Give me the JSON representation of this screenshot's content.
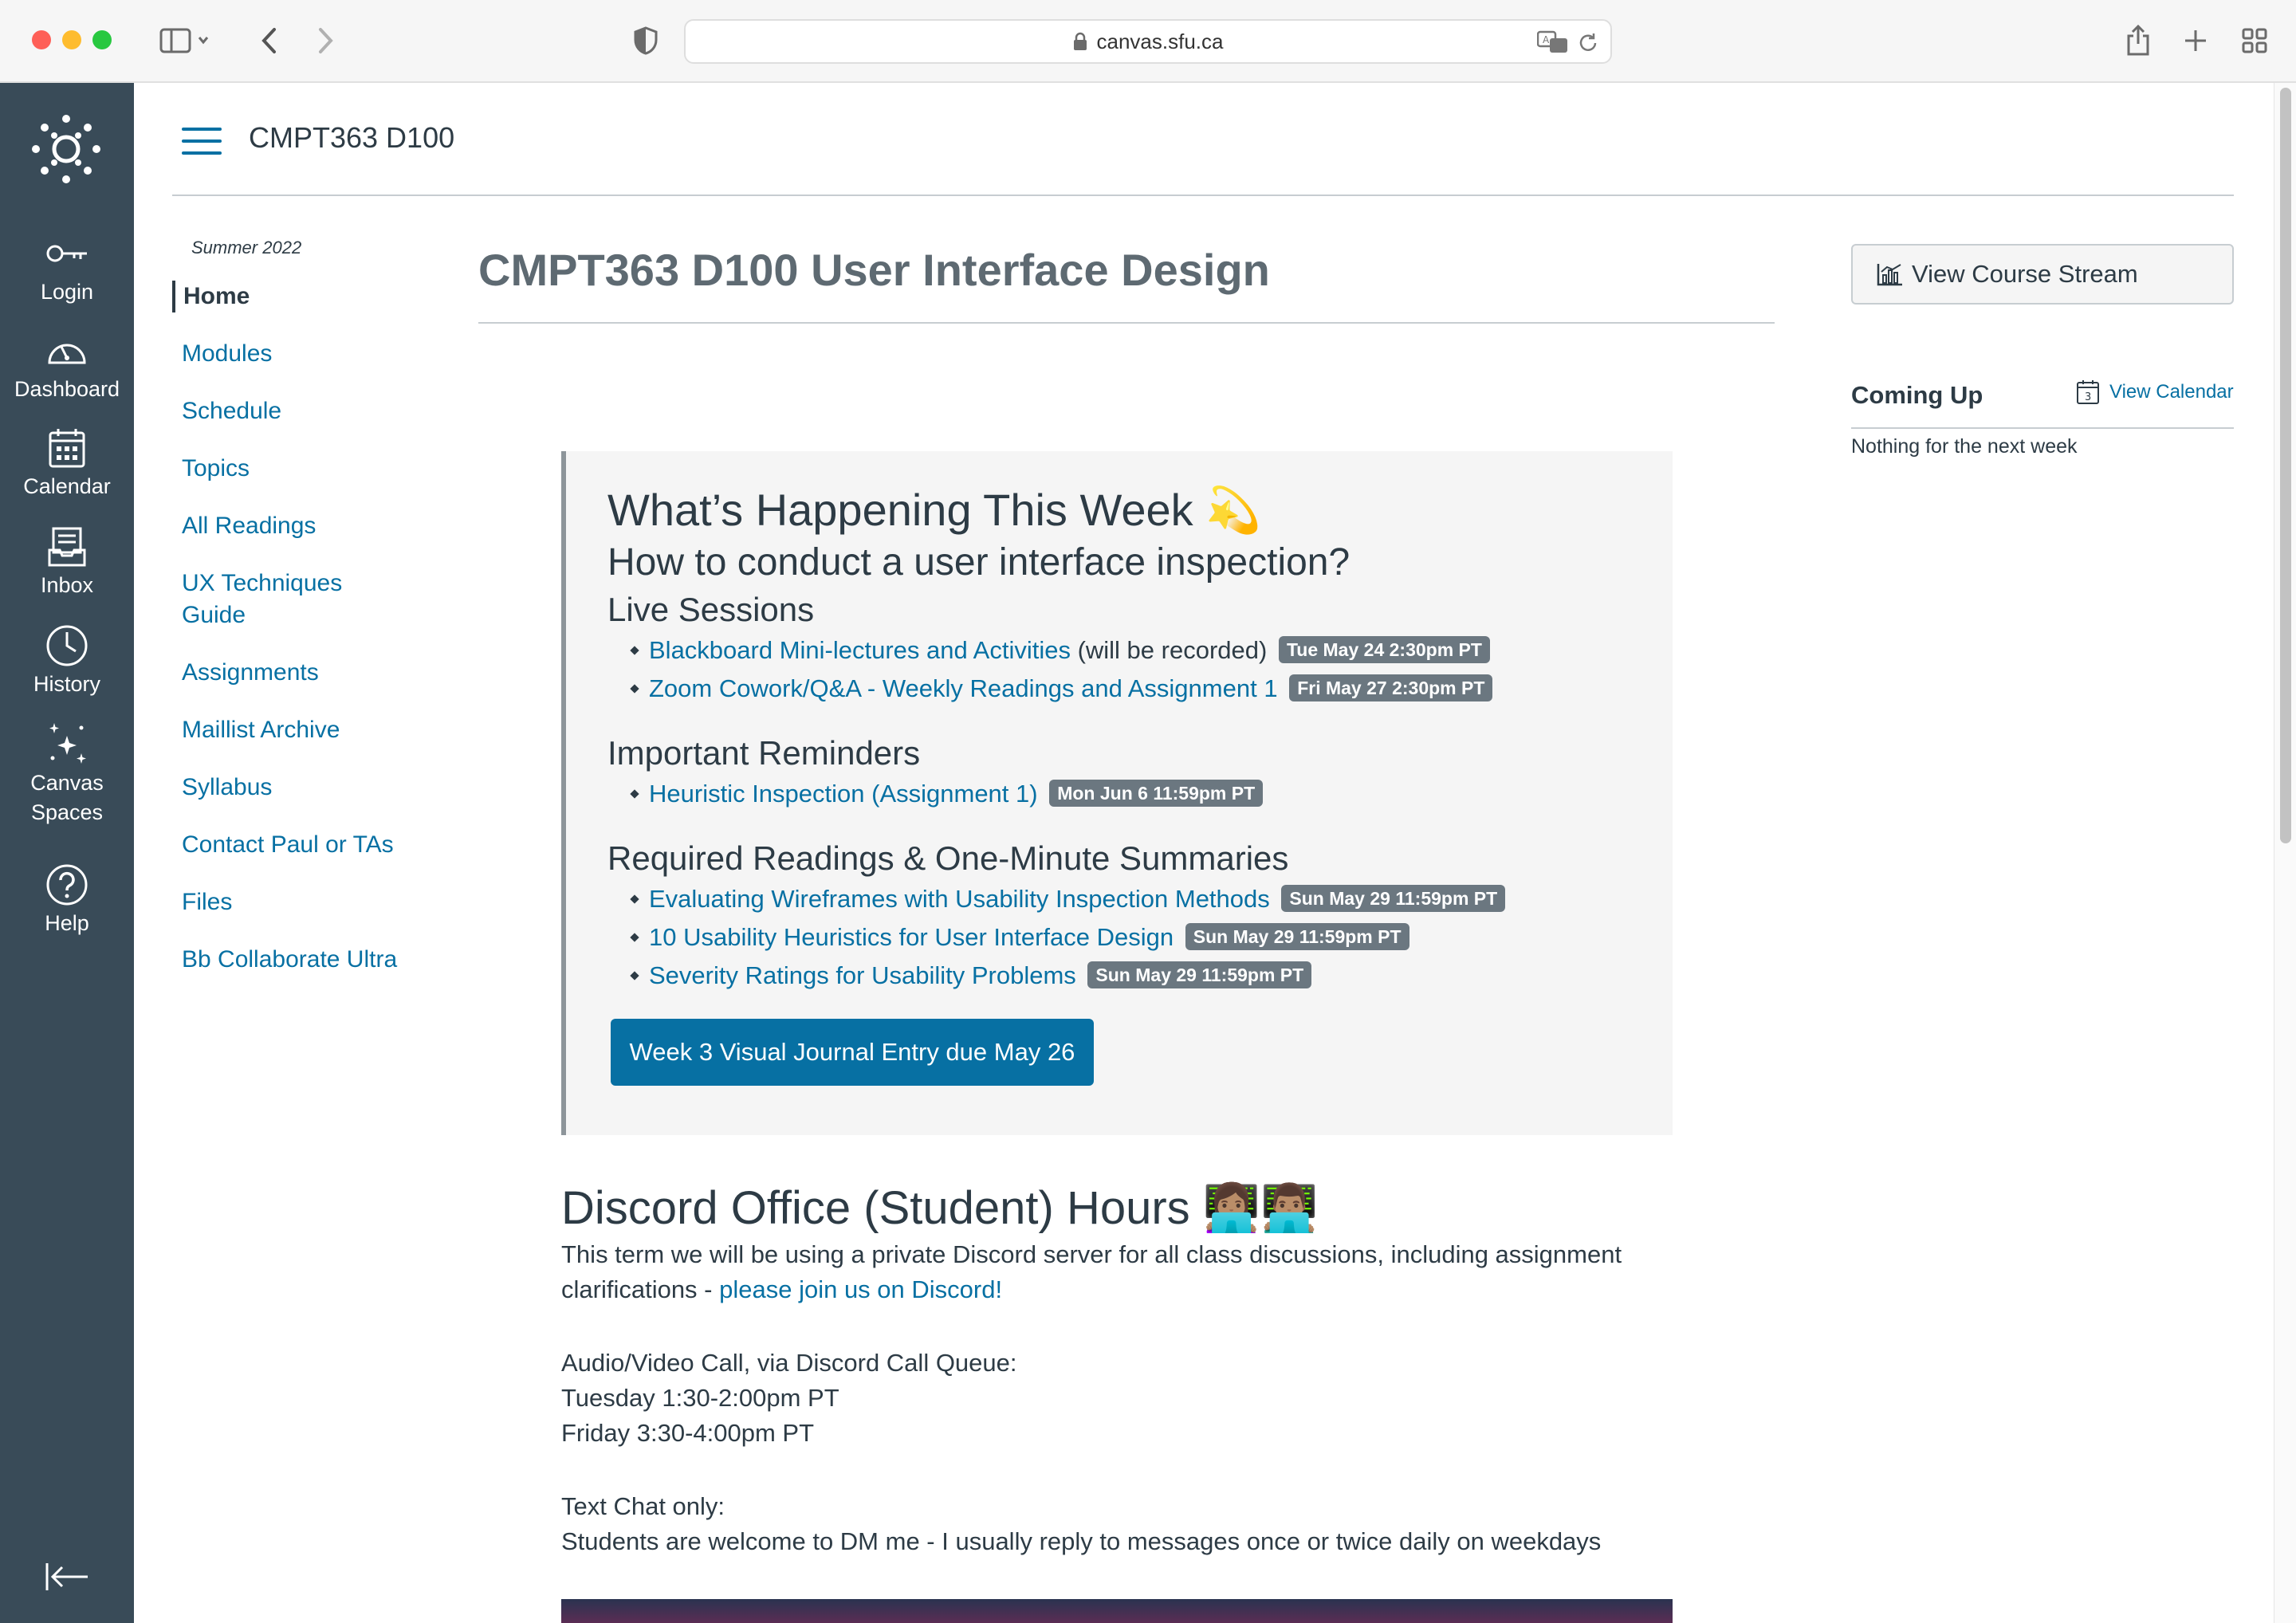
{
  "browser": {
    "url": "canvas.sfu.ca"
  },
  "global_nav": {
    "items": [
      {
        "label": "Login",
        "icon": "key-icon"
      },
      {
        "label": "Dashboard",
        "icon": "dashboard-icon"
      },
      {
        "label": "Calendar",
        "icon": "calendar-icon"
      },
      {
        "label": "Inbox",
        "icon": "inbox-icon"
      },
      {
        "label": "History",
        "icon": "clock-icon"
      },
      {
        "label": "Canvas",
        "label2": "Spaces",
        "icon": "sparkles-icon"
      },
      {
        "label": "Help",
        "icon": "help-icon"
      }
    ]
  },
  "header": {
    "course": "CMPT363 D100"
  },
  "course_nav": {
    "term": "Summer 2022",
    "items": [
      {
        "label": "Home"
      },
      {
        "label": "Modules"
      },
      {
        "label": "Schedule"
      },
      {
        "label": "Topics"
      },
      {
        "label": "All Readings"
      },
      {
        "label": "UX Techniques",
        "label2": "Guide"
      },
      {
        "label": "Assignments"
      },
      {
        "label": "Maillist Archive"
      },
      {
        "label": "Syllabus"
      },
      {
        "label": "Contact Paul or TAs"
      },
      {
        "label": "Files"
      },
      {
        "label": "Bb Collaborate Ultra"
      }
    ]
  },
  "main": {
    "title": "CMPT363 D100 User Interface Design",
    "week": {
      "heading": "What’s Happening This Week 💫",
      "subheading": "How to conduct a user interface inspection?",
      "live_heading": "Live Sessions",
      "live": [
        {
          "link": "Blackboard Mini-lectures and Activities",
          "suffix": " (will be recorded)",
          "badge": "Tue May 24 2:30pm PT"
        },
        {
          "link": "Zoom Cowork/Q&A - Weekly Readings and Assignment 1",
          "suffix": "",
          "badge": "Fri May 27 2:30pm PT"
        }
      ],
      "reminders_heading": "Important Reminders",
      "reminders": [
        {
          "link": "Heuristic Inspection (Assignment 1)",
          "badge": "Mon Jun 6 11:59pm PT"
        }
      ],
      "readings_heading": "Required Readings & One-Minute Summaries",
      "readings": [
        {
          "link": "Evaluating Wireframes with Usability Inspection Methods",
          "badge": "Sun May 29 11:59pm PT"
        },
        {
          "link": "10 Usability Heuristics for User Interface Design",
          "badge": "Sun May 29 11:59pm PT"
        },
        {
          "link": "Severity Ratings for Usability Problems",
          "badge": "Sun May 29 11:59pm PT"
        }
      ],
      "button": "Week 3 Visual Journal Entry due May 26"
    },
    "discord": {
      "heading": "Discord Office (Student) Hours 👩🏽‍💻👨🏽‍💻",
      "intro": "This term we will be using a private Discord server for all class discussions, including assignment",
      "intro2": "clarifications - ",
      "intro_link": "please join us on Discord!",
      "call_label": "Audio/Video Call, via Discord Call Queue:",
      "call_tue": "Tuesday 1:30-2:00pm PT",
      "call_fri": "Friday 3:30-4:00pm PT",
      "chat_label": "Text Chat only:",
      "chat_text": "Students are welcome to DM me - I usually reply to messages once or twice daily on weekdays"
    }
  },
  "sidebar": {
    "stream_button": "View Course Stream",
    "coming_up": "Coming Up",
    "view_calendar": "View Calendar",
    "empty": "Nothing for the next week"
  },
  "colors": {
    "nav_bg": "#394b58",
    "link": "#0770a3",
    "badge": "#6b7780",
    "button": "#0770a3"
  }
}
